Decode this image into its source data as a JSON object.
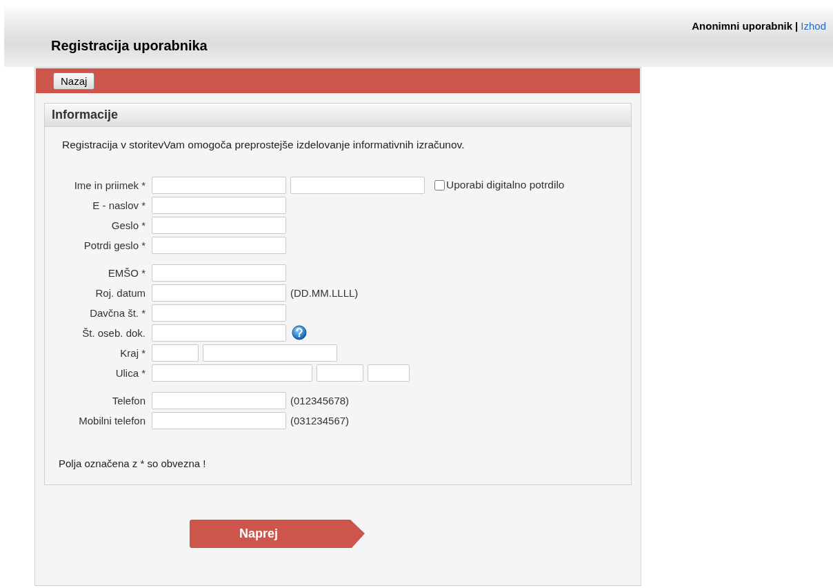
{
  "user_bar": {
    "user": "Anonimni uporabnik",
    "separator": "|",
    "logout_link": "Izhod"
  },
  "page_title": "Registracija uporabnika",
  "toolbar": {
    "back_button": "Nazaj"
  },
  "section": {
    "title": "Informacije",
    "intro": "Registracija v storitevVam omogoča preprostejše izdelovanje informativnih izračunov.",
    "form_groups": [
      [
        {
          "label": "Ime in priimek *",
          "fields": [
            {
              "kind": "normal"
            },
            {
              "kind": "normal"
            }
          ],
          "checkbox": {
            "label": "Uporabi digitalno potrdilo",
            "checked": false
          }
        },
        {
          "label": "E - naslov *",
          "fields": [
            {
              "kind": "normal"
            }
          ]
        },
        {
          "label": "Geslo *",
          "fields": [
            {
              "kind": "normal"
            }
          ]
        },
        {
          "label": "Potrdi geslo *",
          "fields": [
            {
              "kind": "normal"
            }
          ]
        }
      ],
      [
        {
          "label": "EMŠO *",
          "fields": [
            {
              "kind": "normal"
            }
          ]
        },
        {
          "label": "Roj. datum",
          "fields": [
            {
              "kind": "normal"
            }
          ],
          "hint": "(DD.MM.LLLL)"
        },
        {
          "label": "Davčna št. *",
          "fields": [
            {
              "kind": "normal"
            }
          ]
        },
        {
          "label": "Št. oseb. dok.",
          "fields": [
            {
              "kind": "normal"
            }
          ],
          "help": true
        },
        {
          "label": "Kraj *",
          "fields": [
            {
              "kind": "short"
            },
            {
              "kind": "normal"
            }
          ]
        },
        {
          "label": "Ulica *",
          "fields": [
            {
              "kind": "long"
            },
            {
              "kind": "short"
            },
            {
              "kind": "tiny"
            }
          ]
        }
      ],
      [
        {
          "label": "Telefon",
          "fields": [
            {
              "kind": "normal"
            }
          ],
          "hint": "(012345678)"
        },
        {
          "label": "Mobilni telefon",
          "fields": [
            {
              "kind": "normal"
            }
          ],
          "hint": "(031234567)"
        }
      ]
    ],
    "footnote": "Polja označena z * so obvezna !"
  },
  "next_button": "Naprej"
}
